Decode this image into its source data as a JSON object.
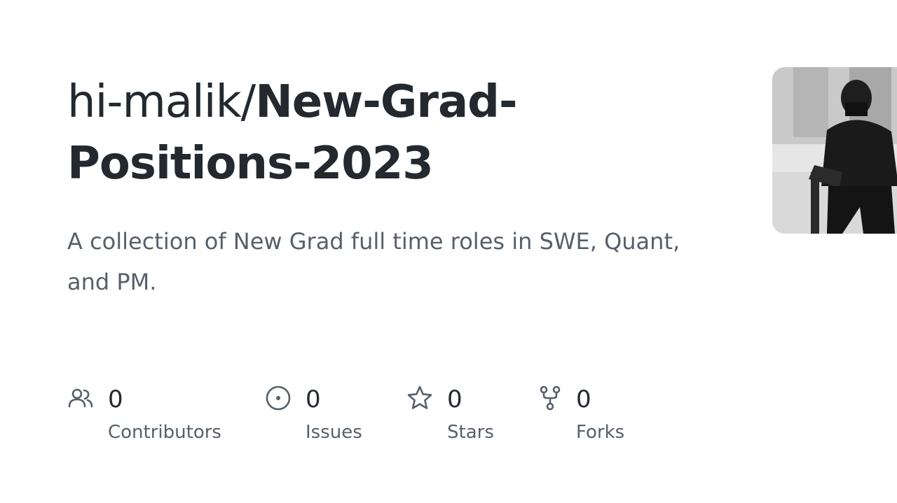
{
  "repo": {
    "owner": "hi-malik/",
    "name": "New-Grad-Positions-2023",
    "description": "A collection of New Grad full time roles in SWE, Quant, and PM."
  },
  "stats": [
    {
      "icon": "people-icon",
      "count": "0",
      "label": "Contributors"
    },
    {
      "icon": "issue-icon",
      "count": "0",
      "label": "Issues"
    },
    {
      "icon": "star-icon",
      "count": "0",
      "label": "Stars"
    },
    {
      "icon": "fork-icon",
      "count": "0",
      "label": "Forks"
    }
  ],
  "colors": {
    "title": "#24292f",
    "muted": "#57606a",
    "background": "#ffffff"
  }
}
